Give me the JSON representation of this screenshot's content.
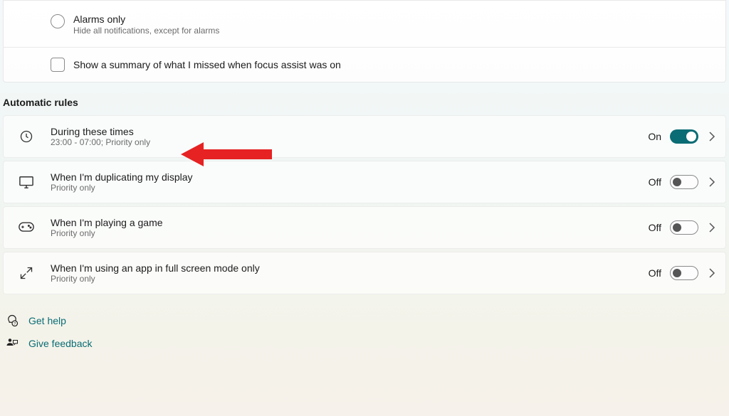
{
  "top_options": {
    "alarms_only": {
      "title": "Alarms only",
      "subtitle": "Hide all notifications, except for alarms"
    },
    "summary_checkbox": "Show a summary of what I missed when focus assist was on"
  },
  "section_heading": "Automatic rules",
  "rules": [
    {
      "title": "During these times",
      "subtitle": "23:00 - 07:00; Priority only",
      "state_label": "On",
      "on": true
    },
    {
      "title": "When I'm duplicating my display",
      "subtitle": "Priority only",
      "state_label": "Off",
      "on": false
    },
    {
      "title": "When I'm playing a game",
      "subtitle": "Priority only",
      "state_label": "Off",
      "on": false
    },
    {
      "title": "When I'm using an app in full screen mode only",
      "subtitle": "Priority only",
      "state_label": "Off",
      "on": false
    }
  ],
  "footer": {
    "get_help": "Get help",
    "give_feedback": "Give feedback"
  }
}
